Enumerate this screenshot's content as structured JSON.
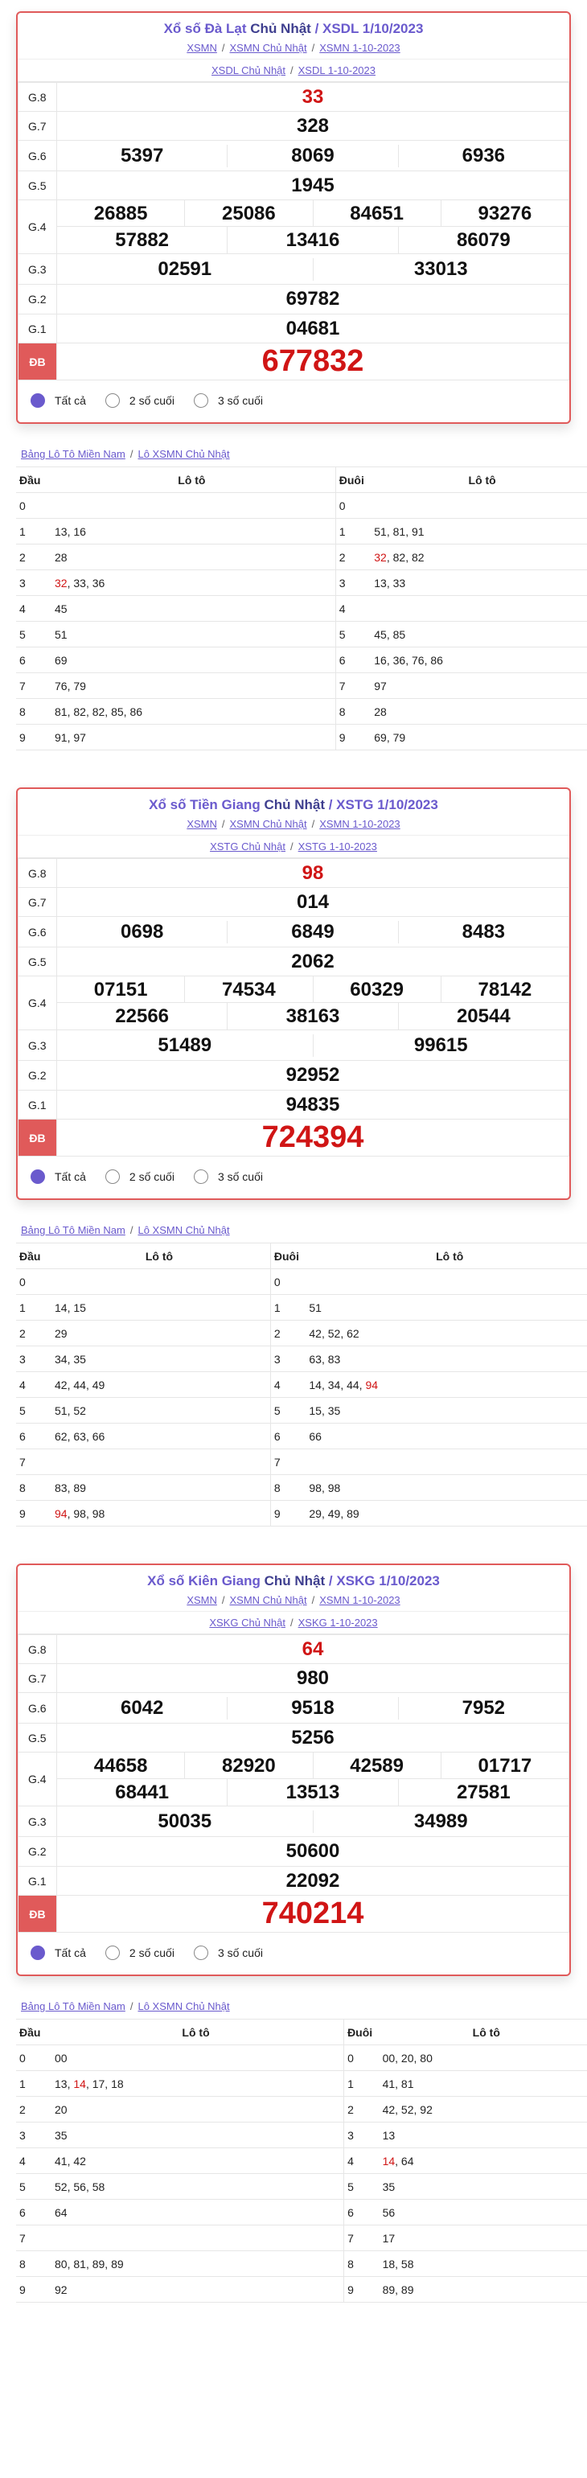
{
  "radio_labels": [
    "Tất cả",
    "2 số cuối",
    "3 số cuối"
  ],
  "loto_links": [
    "Bảng Lô Tô Miền Nam",
    "Lô XSMN Chủ Nhật"
  ],
  "loto_headers": [
    "Đầu",
    "Lô tô",
    "Đuôi",
    "Lô tô"
  ],
  "colors": {
    "accent": "#6a5acd",
    "red": "#d01515",
    "border": "#e05a5a"
  },
  "sections": [
    {
      "title_main": "Xổ số Đà Lạt",
      "title_day": "Chủ Nhật",
      "title_code": "/ XSDL 1/10/2023",
      "links": [
        "XSMN",
        "XSMN Chủ Nhật",
        "XSMN 1-10-2023"
      ],
      "links2": [
        "XSDL Chủ Nhật",
        "XSDL 1-10-2023"
      ],
      "g8": "33",
      "g7": "328",
      "g6": [
        "5397",
        "8069",
        "6936"
      ],
      "g5": "1945",
      "g4a": [
        "26885",
        "25086",
        "84651",
        "93276"
      ],
      "g4b": [
        "57882",
        "13416",
        "86079"
      ],
      "g3": [
        "02591",
        "33013"
      ],
      "g2": "69782",
      "g1": "04681",
      "db": "677832",
      "dau": [
        {
          "k": "0",
          "v": []
        },
        {
          "k": "1",
          "v": [
            {
              "t": "13"
            },
            {
              "t": "16"
            }
          ]
        },
        {
          "k": "2",
          "v": [
            {
              "t": "28"
            }
          ]
        },
        {
          "k": "3",
          "v": [
            {
              "t": "32",
              "hot": true
            },
            {
              "t": "33"
            },
            {
              "t": "36"
            }
          ]
        },
        {
          "k": "4",
          "v": [
            {
              "t": "45"
            }
          ]
        },
        {
          "k": "5",
          "v": [
            {
              "t": "51"
            }
          ]
        },
        {
          "k": "6",
          "v": [
            {
              "t": "69"
            }
          ]
        },
        {
          "k": "7",
          "v": [
            {
              "t": "76"
            },
            {
              "t": "79"
            }
          ]
        },
        {
          "k": "8",
          "v": [
            {
              "t": "81"
            },
            {
              "t": "82"
            },
            {
              "t": "82"
            },
            {
              "t": "85"
            },
            {
              "t": "86"
            }
          ]
        },
        {
          "k": "9",
          "v": [
            {
              "t": "91"
            },
            {
              "t": "97"
            }
          ]
        }
      ],
      "duoi": [
        {
          "k": "0",
          "v": []
        },
        {
          "k": "1",
          "v": [
            {
              "t": "51"
            },
            {
              "t": "81"
            },
            {
              "t": "91"
            }
          ]
        },
        {
          "k": "2",
          "v": [
            {
              "t": "32",
              "hot": true
            },
            {
              "t": "82"
            },
            {
              "t": "82"
            }
          ]
        },
        {
          "k": "3",
          "v": [
            {
              "t": "13"
            },
            {
              "t": "33"
            }
          ]
        },
        {
          "k": "4",
          "v": []
        },
        {
          "k": "5",
          "v": [
            {
              "t": "45"
            },
            {
              "t": "85"
            }
          ]
        },
        {
          "k": "6",
          "v": [
            {
              "t": "16"
            },
            {
              "t": "36"
            },
            {
              "t": "76"
            },
            {
              "t": "86"
            }
          ]
        },
        {
          "k": "7",
          "v": [
            {
              "t": "97"
            }
          ]
        },
        {
          "k": "8",
          "v": [
            {
              "t": "28"
            }
          ]
        },
        {
          "k": "9",
          "v": [
            {
              "t": "69"
            },
            {
              "t": "79"
            }
          ]
        }
      ]
    },
    {
      "title_main": "Xổ số Tiền Giang",
      "title_day": "Chủ Nhật",
      "title_code": "/ XSTG 1/10/2023",
      "links": [
        "XSMN",
        "XSMN Chủ Nhật",
        "XSMN 1-10-2023"
      ],
      "links2": [
        "XSTG Chủ Nhật",
        "XSTG 1-10-2023"
      ],
      "g8": "98",
      "g7": "014",
      "g6": [
        "0698",
        "6849",
        "8483"
      ],
      "g5": "2062",
      "g4a": [
        "07151",
        "74534",
        "60329",
        "78142"
      ],
      "g4b": [
        "22566",
        "38163",
        "20544"
      ],
      "g3": [
        "51489",
        "99615"
      ],
      "g2": "92952",
      "g1": "94835",
      "db": "724394",
      "dau": [
        {
          "k": "0",
          "v": []
        },
        {
          "k": "1",
          "v": [
            {
              "t": "14"
            },
            {
              "t": "15"
            }
          ]
        },
        {
          "k": "2",
          "v": [
            {
              "t": "29"
            }
          ]
        },
        {
          "k": "3",
          "v": [
            {
              "t": "34"
            },
            {
              "t": "35"
            }
          ]
        },
        {
          "k": "4",
          "v": [
            {
              "t": "42"
            },
            {
              "t": "44"
            },
            {
              "t": "49"
            }
          ]
        },
        {
          "k": "5",
          "v": [
            {
              "t": "51"
            },
            {
              "t": "52"
            }
          ]
        },
        {
          "k": "6",
          "v": [
            {
              "t": "62"
            },
            {
              "t": "63"
            },
            {
              "t": "66"
            }
          ]
        },
        {
          "k": "7",
          "v": []
        },
        {
          "k": "8",
          "v": [
            {
              "t": "83"
            },
            {
              "t": "89"
            }
          ]
        },
        {
          "k": "9",
          "v": [
            {
              "t": "94",
              "hot": true
            },
            {
              "t": "98"
            },
            {
              "t": "98"
            }
          ]
        }
      ],
      "duoi": [
        {
          "k": "0",
          "v": []
        },
        {
          "k": "1",
          "v": [
            {
              "t": "51"
            }
          ]
        },
        {
          "k": "2",
          "v": [
            {
              "t": "42"
            },
            {
              "t": "52"
            },
            {
              "t": "62"
            }
          ]
        },
        {
          "k": "3",
          "v": [
            {
              "t": "63"
            },
            {
              "t": "83"
            }
          ]
        },
        {
          "k": "4",
          "v": [
            {
              "t": "14"
            },
            {
              "t": "34"
            },
            {
              "t": "44"
            },
            {
              "t": "94",
              "hot": true
            }
          ]
        },
        {
          "k": "5",
          "v": [
            {
              "t": "15"
            },
            {
              "t": "35"
            }
          ]
        },
        {
          "k": "6",
          "v": [
            {
              "t": "66"
            }
          ]
        },
        {
          "k": "7",
          "v": []
        },
        {
          "k": "8",
          "v": [
            {
              "t": "98"
            },
            {
              "t": "98"
            }
          ]
        },
        {
          "k": "9",
          "v": [
            {
              "t": "29"
            },
            {
              "t": "49"
            },
            {
              "t": "89"
            }
          ]
        }
      ]
    },
    {
      "title_main": "Xổ số Kiên Giang",
      "title_day": "Chủ Nhật",
      "title_code": "/ XSKG 1/10/2023",
      "links": [
        "XSMN",
        "XSMN Chủ Nhật",
        "XSMN 1-10-2023"
      ],
      "links2": [
        "XSKG Chủ Nhật",
        "XSKG 1-10-2023"
      ],
      "g8": "64",
      "g7": "980",
      "g6": [
        "6042",
        "9518",
        "7952"
      ],
      "g5": "5256",
      "g4a": [
        "44658",
        "82920",
        "42589",
        "01717"
      ],
      "g4b": [
        "68441",
        "13513",
        "27581"
      ],
      "g3": [
        "50035",
        "34989"
      ],
      "g2": "50600",
      "g1": "22092",
      "db": "740214",
      "dau": [
        {
          "k": "0",
          "v": [
            {
              "t": "00"
            }
          ]
        },
        {
          "k": "1",
          "v": [
            {
              "t": "13"
            },
            {
              "t": "14",
              "hot": true
            },
            {
              "t": "17"
            },
            {
              "t": "18"
            }
          ]
        },
        {
          "k": "2",
          "v": [
            {
              "t": "20"
            }
          ]
        },
        {
          "k": "3",
          "v": [
            {
              "t": "35"
            }
          ]
        },
        {
          "k": "4",
          "v": [
            {
              "t": "41"
            },
            {
              "t": "42"
            }
          ]
        },
        {
          "k": "5",
          "v": [
            {
              "t": "52"
            },
            {
              "t": "56"
            },
            {
              "t": "58"
            }
          ]
        },
        {
          "k": "6",
          "v": [
            {
              "t": "64"
            }
          ]
        },
        {
          "k": "7",
          "v": []
        },
        {
          "k": "8",
          "v": [
            {
              "t": "80"
            },
            {
              "t": "81"
            },
            {
              "t": "89"
            },
            {
              "t": "89"
            }
          ]
        },
        {
          "k": "9",
          "v": [
            {
              "t": "92"
            }
          ]
        }
      ],
      "duoi": [
        {
          "k": "0",
          "v": [
            {
              "t": "00"
            },
            {
              "t": "20"
            },
            {
              "t": "80"
            }
          ]
        },
        {
          "k": "1",
          "v": [
            {
              "t": "41"
            },
            {
              "t": "81"
            }
          ]
        },
        {
          "k": "2",
          "v": [
            {
              "t": "42"
            },
            {
              "t": "52"
            },
            {
              "t": "92"
            }
          ]
        },
        {
          "k": "3",
          "v": [
            {
              "t": "13"
            }
          ]
        },
        {
          "k": "4",
          "v": [
            {
              "t": "14",
              "hot": true
            },
            {
              "t": "64"
            }
          ]
        },
        {
          "k": "5",
          "v": [
            {
              "t": "35"
            }
          ]
        },
        {
          "k": "6",
          "v": [
            {
              "t": "56"
            }
          ]
        },
        {
          "k": "7",
          "v": [
            {
              "t": "17"
            }
          ]
        },
        {
          "k": "8",
          "v": [
            {
              "t": "18"
            },
            {
              "t": "58"
            }
          ]
        },
        {
          "k": "9",
          "v": [
            {
              "t": "89"
            },
            {
              "t": "89"
            }
          ]
        }
      ]
    }
  ]
}
